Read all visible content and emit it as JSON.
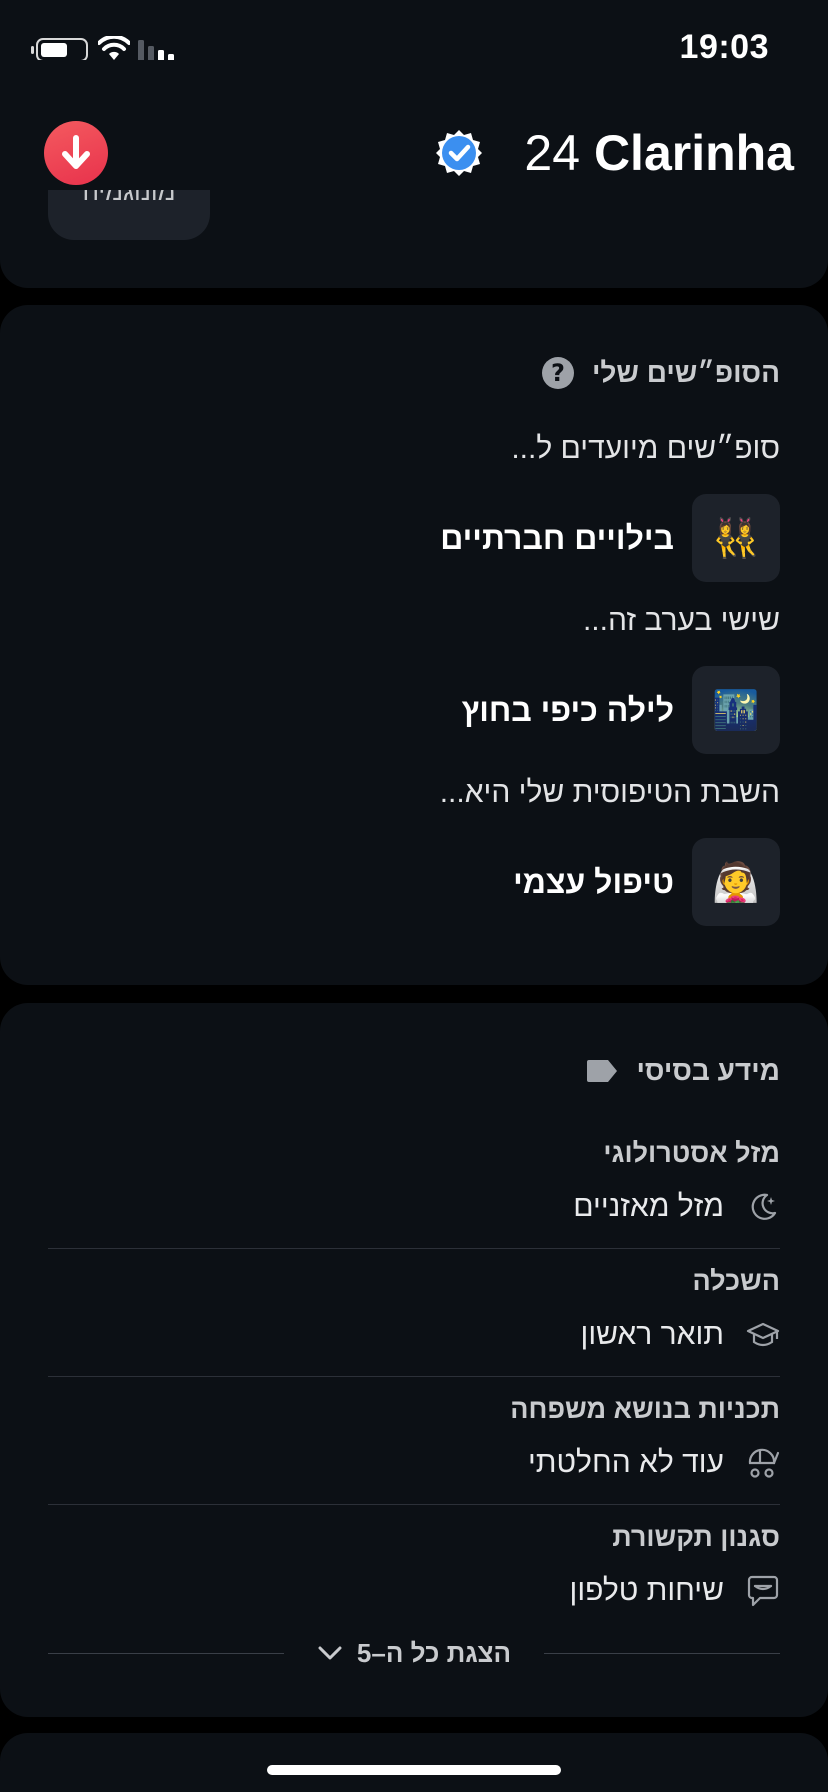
{
  "status_bar": {
    "time": "19:03"
  },
  "profile": {
    "name": "Clarinha",
    "age": "24",
    "partial_chip": "מונוגמיה"
  },
  "weekends": {
    "title": "הסופ״שים שלי",
    "items": [
      {
        "prompt": "סופ״שים מיועדים ל...",
        "answer": "בילויים חברתיים",
        "emoji": "👯‍♀️"
      },
      {
        "prompt": "שישי בערב זה...",
        "answer": "לילה כיפי בחוץ",
        "emoji": "🌃"
      },
      {
        "prompt": "השבת הטיפוסית שלי היא...",
        "answer": "טיפול עצמי",
        "emoji": "👰"
      }
    ]
  },
  "basic_info": {
    "title": "מידע בסיסי",
    "rows": [
      {
        "label": "מזל אסטרולוגי",
        "value": "מזל מאזניים",
        "icon": "moon-icon"
      },
      {
        "label": "השכלה",
        "value": "תואר ראשון",
        "icon": "graduation-cap-icon"
      },
      {
        "label": "תכניות בנושא משפחה",
        "value": "עוד לא החלטתי",
        "icon": "baby-stroller-icon"
      },
      {
        "label": "סגנון תקשורת",
        "value": "שיחות טלפון",
        "icon": "chat-bubble-icon"
      }
    ],
    "show_all_label": "הצגת כל ה–5"
  },
  "colors": {
    "background": "#000000",
    "card": "#0c1015",
    "chip": "#1d222a",
    "accent_red": "#ec3b50",
    "verified_blue": "#3b8ff0"
  }
}
